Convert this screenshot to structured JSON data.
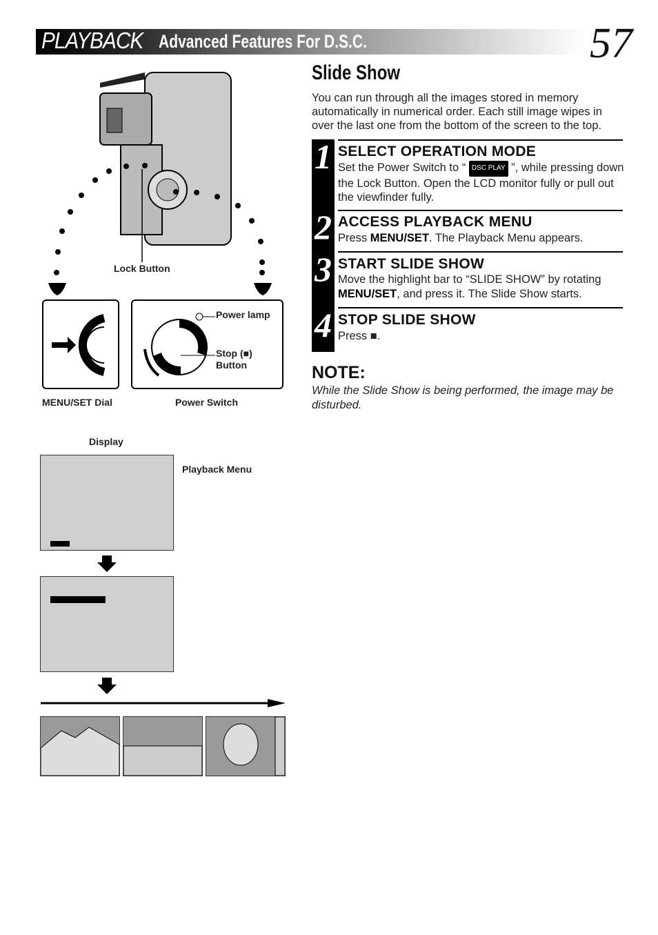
{
  "header": {
    "section": "PLAYBACK",
    "subtitle": "Advanced Features For D.S.C.",
    "page_number": "57"
  },
  "slide_show": {
    "title": "Slide Show",
    "intro": "You can run through all the images stored in memory automatically in numerical order. Each still image wipes in over the last one from the bottom of the screen to the top."
  },
  "steps": [
    {
      "num": "1",
      "title": "SELECT OPERATION MODE",
      "pre": "Set the Power Switch to “ ",
      "chip": "DSC PLAY",
      "post": " ”, while pressing down the Lock Button. Open the LCD monitor fully or pull out the viewfinder fully."
    },
    {
      "num": "2",
      "title": "ACCESS PLAYBACK MENU",
      "pre": "Press ",
      "bold": "MENU/SET",
      "post": ". The Playback Menu appears."
    },
    {
      "num": "3",
      "title": "START SLIDE SHOW",
      "pre": "Move the highlight bar to “SLIDE SHOW” by rotating ",
      "bold": "MENU/SET",
      "post": ", and press it. The Slide Show starts."
    },
    {
      "num": "4",
      "title": "STOP SLIDE SHOW",
      "pre": "Press ■."
    }
  ],
  "note": {
    "title": "NOTE:",
    "text": "While the Slide Show is being performed, the image may be disturbed."
  },
  "labels": {
    "lock_button": "Lock Button",
    "power_lamp": "Power lamp",
    "stop_button": "Stop (■)",
    "stop_button2": "Button",
    "menu_set_dial": "MENU/SET Dial",
    "power_switch": "Power Switch",
    "display": "Display",
    "playback_menu": "Playback Menu"
  }
}
